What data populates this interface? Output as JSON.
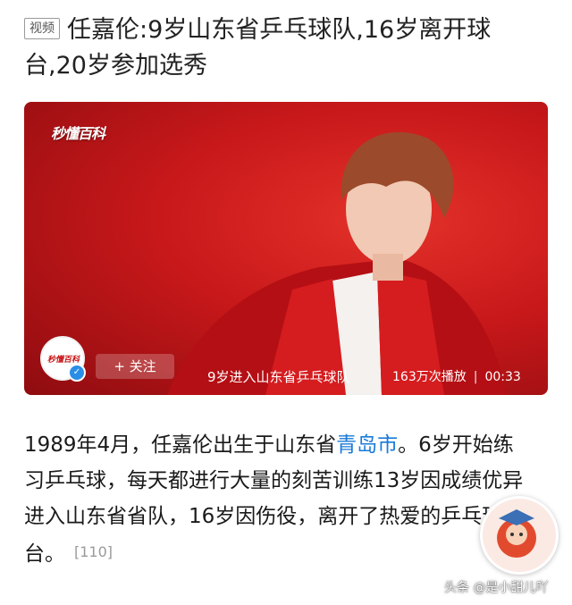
{
  "header": {
    "tag": "视频",
    "title": "任嘉伦:9岁山东省乒乓球队,16岁离开球台,20岁参加选秀"
  },
  "video": {
    "brand_logo_text": "秒懂百科",
    "account_logo_text": "秒懂百科",
    "follow_label": "+ 关注",
    "caption": "9岁进入山东省乒乓球队",
    "views": "163万次播放",
    "separator": "|",
    "duration": "00:33"
  },
  "article": {
    "part1": "1989年4月，任嘉伦出生于山东省",
    "link": "青岛市",
    "part2": "。6岁开始练习乒乓球，每天都进行大量的刻苦训练13岁因成绩优异进入山东省省队，16岁因伤役，离开了热爱的乒乓球台。",
    "citation": "[110]"
  },
  "watermark": "头条 @是小甜儿吖",
  "colors": {
    "accent_red": "#c8181a",
    "link_blue": "#1a7ad8"
  }
}
